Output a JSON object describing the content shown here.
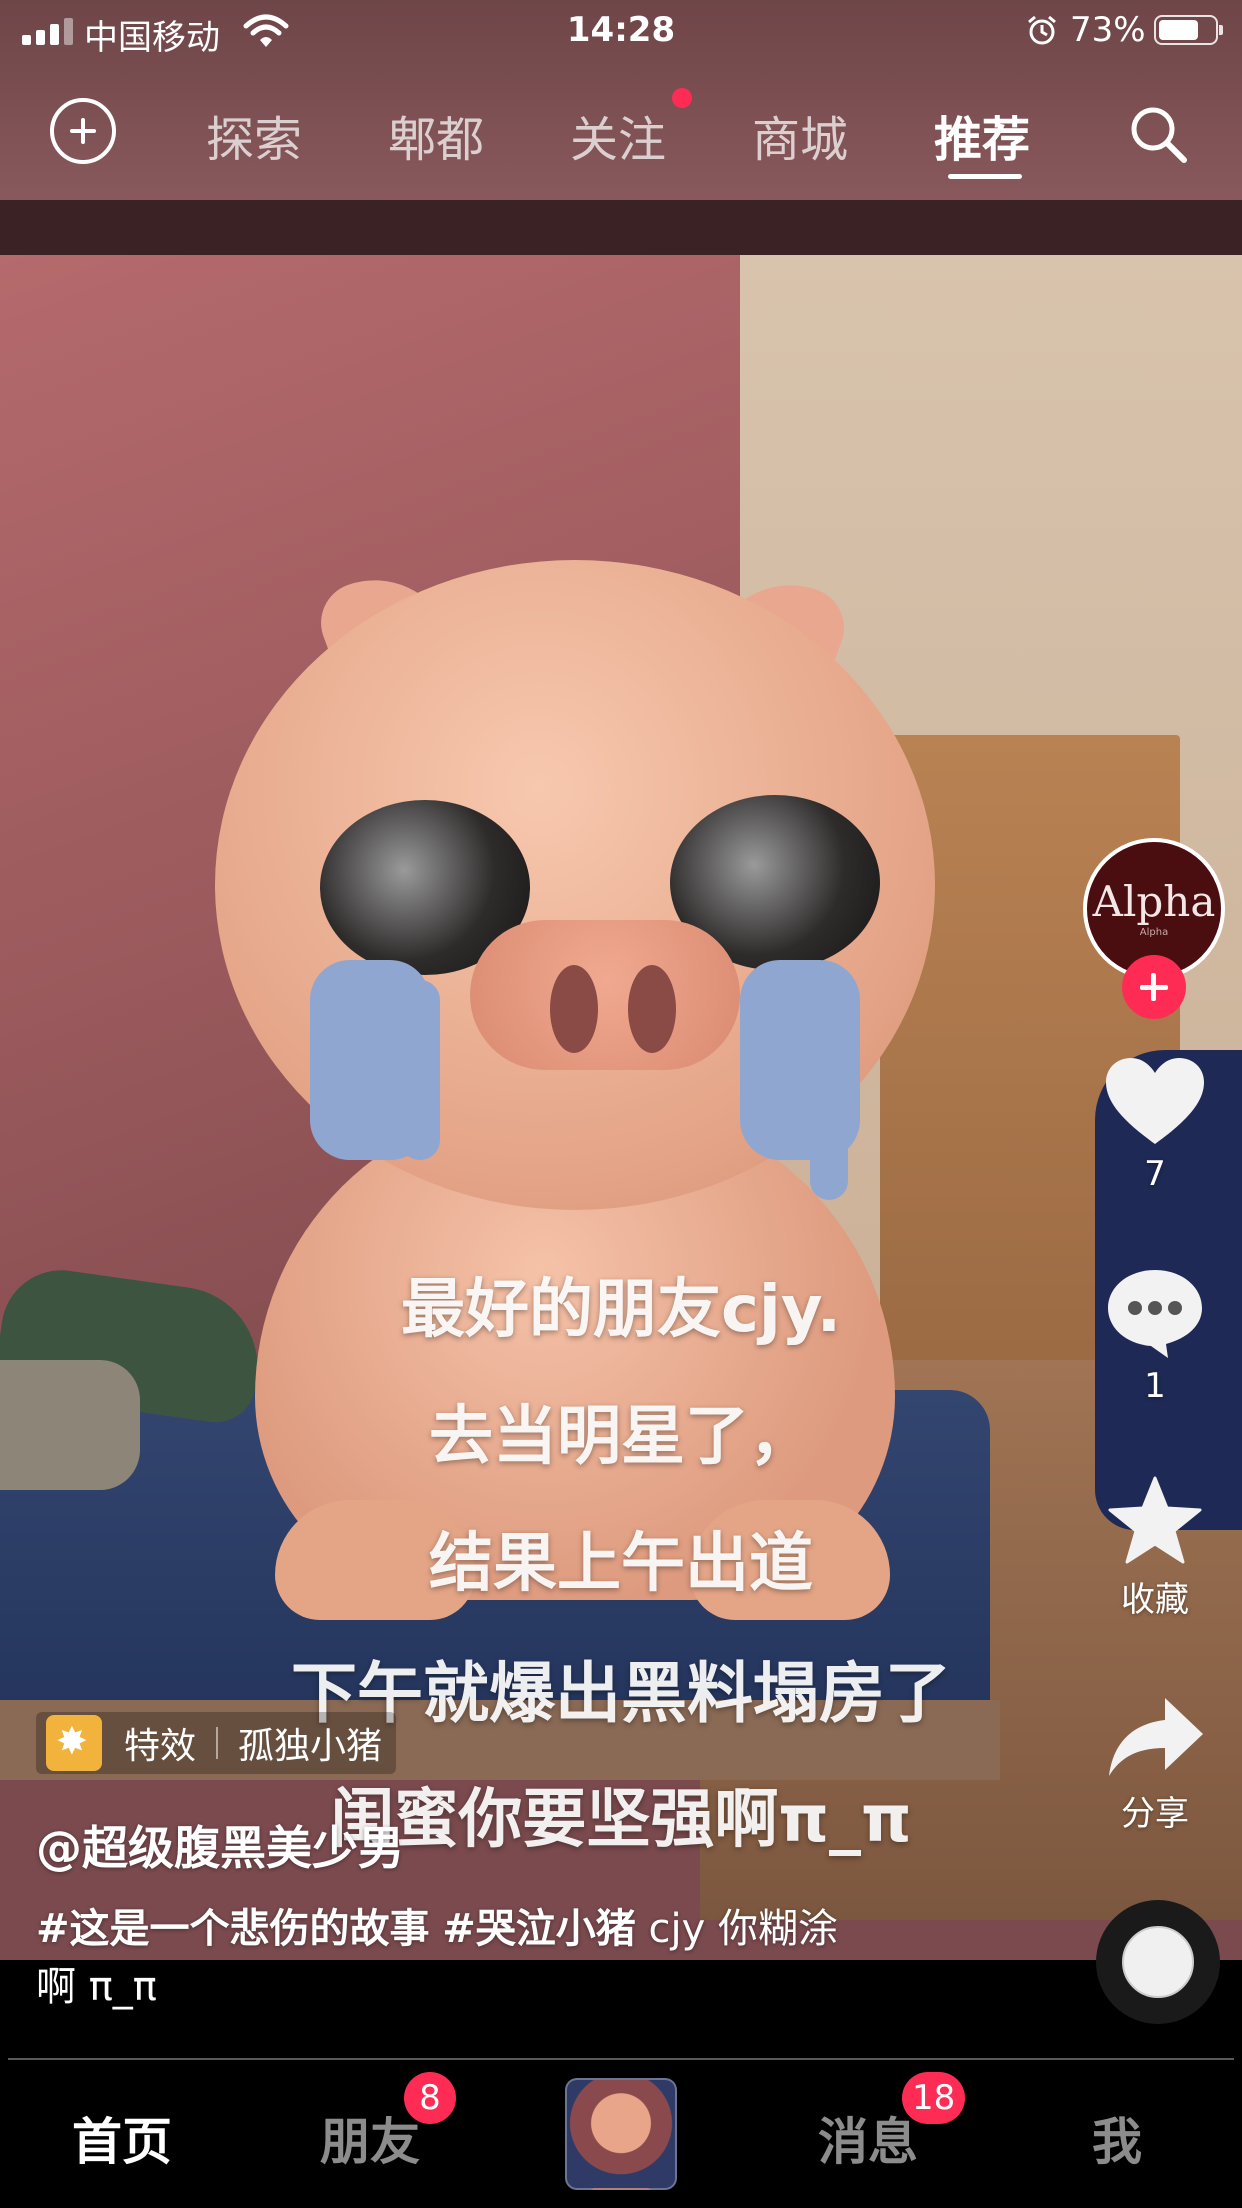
{
  "status_bar": {
    "carrier": "中国移动",
    "time": "14:28",
    "battery_percent": "73%",
    "battery_level": 0.73,
    "icons": [
      "signal-icon",
      "wifi-icon",
      "alarm-icon",
      "battery-icon"
    ]
  },
  "top_nav": {
    "tabs": [
      {
        "label": "探索"
      },
      {
        "label": "郫都"
      },
      {
        "label": "关注",
        "has_dot": true
      },
      {
        "label": "商城"
      },
      {
        "label": "推荐",
        "active": true
      }
    ],
    "left_icon": "plus-circle-icon",
    "right_icon": "search-icon"
  },
  "video": {
    "subtitles": [
      "最好的朋友cjy.",
      "去当明星了，",
      "结果上午出道",
      "下午就爆出黑料塌房了",
      "闺蜜你要坚强啊π_π"
    ]
  },
  "creator": {
    "avatar_text": "Alpha",
    "avatar_small": "Alpha"
  },
  "actions": {
    "like_count": "7",
    "comment_count": "1",
    "favorite_label": "收藏",
    "share_label": "分享"
  },
  "info": {
    "effect_label": "特效",
    "effect_name": "孤独小猪",
    "username": "@超级腹黑美少男",
    "caption_tags": [
      "#这是一个悲伤的故事",
      "#哭泣小猪"
    ],
    "caption_text_1": "cjy 你糊涂",
    "caption_text_2": "啊 π_π"
  },
  "bottom_nav": {
    "home": "首页",
    "friends": "朋友",
    "friends_badge": "8",
    "messages": "消息",
    "messages_badge": "18",
    "me": "我"
  },
  "colors": {
    "accent": "#fe2c55",
    "effect_icon": "#f2b33d"
  }
}
